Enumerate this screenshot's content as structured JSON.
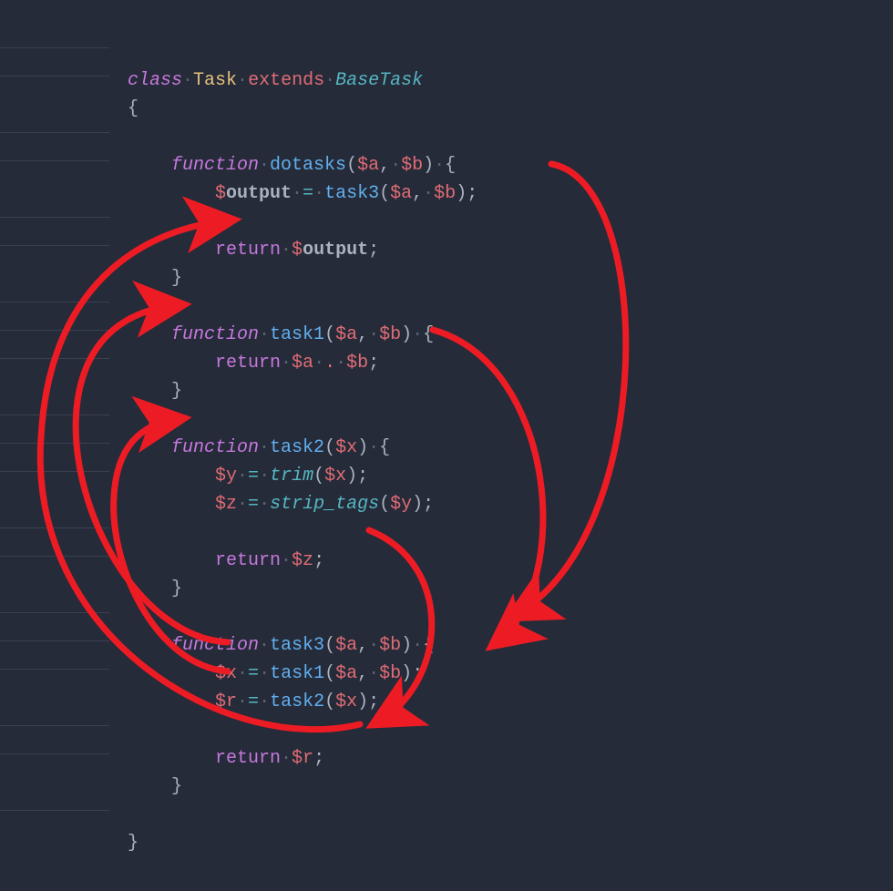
{
  "colors": {
    "background": "#252b39",
    "keyword": "#c678dd",
    "class": "#e5c07b",
    "extends": "#e06c75",
    "base": "#56b6c2",
    "function": "#61afef",
    "builtin": "#56b6c2",
    "variable": "#e06c75",
    "text": "#abb2bf",
    "arrow": "#ed1c24",
    "guide": "#3a4050",
    "whitespace": "#5c6370"
  },
  "class_decl": {
    "kw": "class",
    "name": "Task",
    "extends_kw": "extends",
    "base": "BaseTask"
  },
  "open_brace": "{",
  "close_brace": "}",
  "dotasks": {
    "kw": "function",
    "name": "dotasks",
    "params_open": "(",
    "p1": "$a",
    "comma": ",",
    "p2": "$b",
    "params_close": ")",
    "body_open": "{",
    "assign": {
      "var": "$output",
      "eq": "=",
      "call": "task3",
      "a": "$a",
      "b": "$b"
    },
    "ret": {
      "kw": "return",
      "var": "$output"
    },
    "body_close": "}"
  },
  "task1": {
    "kw": "function",
    "name": "task1",
    "p1": "$a",
    "p2": "$b",
    "ret": {
      "kw": "return",
      "a": "$a",
      "op": ".",
      "b": "$b"
    }
  },
  "task2": {
    "kw": "function",
    "name": "task2",
    "p1": "$x",
    "l1": {
      "var": "$y",
      "eq": "=",
      "call": "trim",
      "arg": "$x"
    },
    "l2": {
      "var": "$z",
      "eq": "=",
      "call": "strip_tags",
      "arg": "$y"
    },
    "ret": {
      "kw": "return",
      "var": "$z"
    }
  },
  "task3": {
    "kw": "function",
    "name": "task3",
    "p1": "$a",
    "p2": "$b",
    "l1": {
      "var": "$x",
      "eq": "=",
      "call": "task1",
      "a": "$a",
      "b": "$b"
    },
    "l2": {
      "var": "$r",
      "eq": "=",
      "call": "task2",
      "a": "$x"
    },
    "ret": {
      "kw": "return",
      "var": "$r"
    }
  },
  "semi": ";",
  "ws_dot": "·"
}
